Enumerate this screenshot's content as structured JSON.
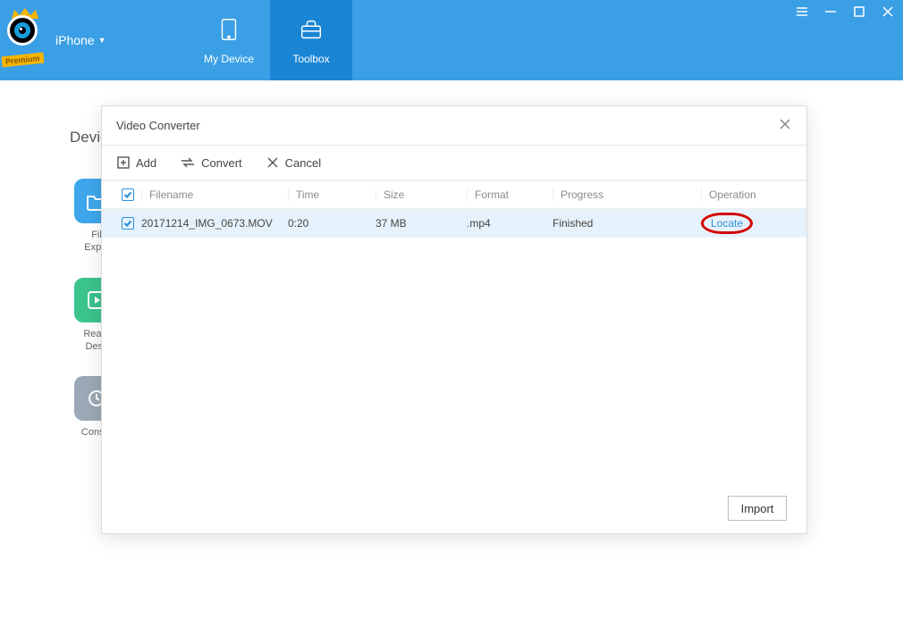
{
  "brand": {
    "badge": "Premium"
  },
  "device_selector": {
    "label": "iPhone"
  },
  "nav": {
    "my_device": "My Device",
    "toolbox": "Toolbox"
  },
  "page": {
    "heading": "Devic",
    "tools": {
      "file_explorer": "Fil\nExplo",
      "realtime": "Real-t\nDesk",
      "console": "Consol"
    }
  },
  "modal": {
    "title": "Video Converter",
    "toolbar": {
      "add": "Add",
      "convert": "Convert",
      "cancel": "Cancel"
    },
    "columns": {
      "filename": "Filename",
      "time": "Time",
      "size": "Size",
      "format": "Format",
      "progress": "Progress",
      "operation": "Operation"
    },
    "rows": [
      {
        "filename": "20171214_IMG_0673.MOV",
        "time": "0:20",
        "size": "37 MB",
        "format": ".mp4",
        "progress": "Finished",
        "operation": "Locate"
      }
    ],
    "footer": {
      "import": "Import"
    }
  }
}
